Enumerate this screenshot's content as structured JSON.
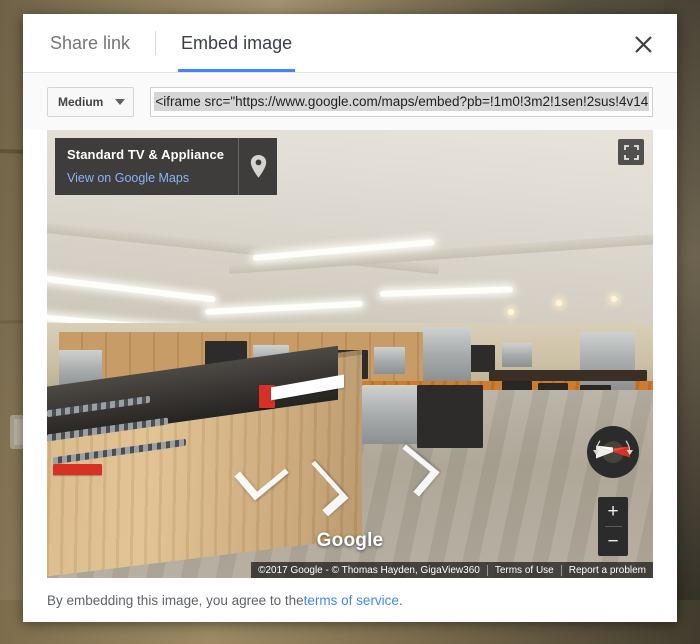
{
  "dialog": {
    "tabs": [
      {
        "label": "Share link",
        "active": false
      },
      {
        "label": "Embed image",
        "active": true
      }
    ],
    "close_label": "×",
    "size_select": {
      "value": "Medium",
      "caret": "chevron-down-icon"
    },
    "embed_input": {
      "value": "<iframe src=\"https://www.google.com/maps/embed?pb=!1m0!3m2!1sen!2sus!4v14",
      "selected": true
    },
    "footer": {
      "text_before": "By embedding this image, you agree to the ",
      "link": "terms of service",
      "text_after": "."
    }
  },
  "pano": {
    "place_card": {
      "title": "Standard TV & Appliance",
      "link": "View on Google Maps",
      "pin_icon": "map-pin-icon"
    },
    "fullscreen_icon": "fullscreen-icon",
    "compass_icon": "compass-icon",
    "zoom_in": "+",
    "zoom_out": "−",
    "watermark": "Google",
    "attribution": {
      "copyright": "©2017 Google - © Thomas Hayden, GigaView360",
      "terms": "Terms of Use",
      "report": "Report a problem"
    }
  },
  "colors": {
    "accent_blue": "#4285f4",
    "link_blue": "#8ab4f8",
    "overlay_dark": "#282726",
    "text_gray": "#5f6368",
    "compass_needle_red": "#d93025"
  }
}
